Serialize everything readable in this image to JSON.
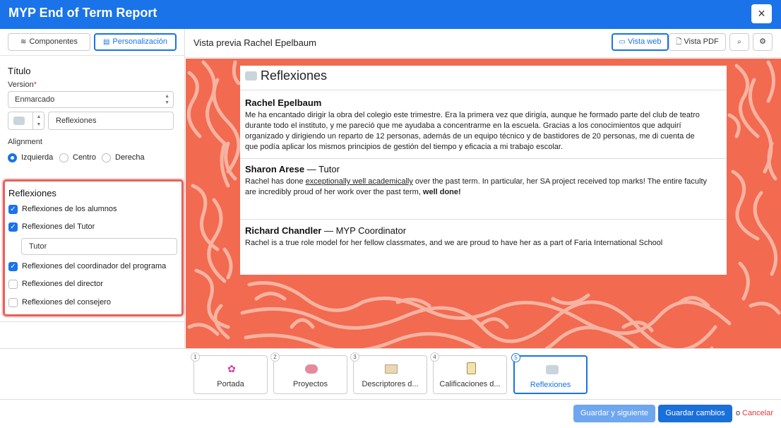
{
  "header": {
    "title": "MYP End of Term Report",
    "close_icon": "×"
  },
  "sidebar": {
    "tabs": [
      {
        "label": "Componentes",
        "icon": "layers-icon"
      },
      {
        "label": "Personalización",
        "icon": "grid-icon",
        "active": true
      }
    ],
    "title_section": {
      "heading": "Título",
      "version_label": "Version",
      "required_mark": "*",
      "version_value": "Enmarcado",
      "icon_value": "💬",
      "title_input_value": "Reflexiones",
      "alignment_label": "Alignment",
      "alignment_options": [
        "Izquierda",
        "Centro",
        "Derecha"
      ],
      "alignment_selected": "Izquierda"
    },
    "reflections": {
      "heading": "Reflexiones",
      "items": [
        {
          "label": "Reflexiones de los alumnos",
          "checked": true
        },
        {
          "label": "Reflexiones del Tutor",
          "checked": true
        },
        {
          "label": "Reflexiones del coordinador del programa",
          "checked": true
        },
        {
          "label": "Reflexiones del director",
          "checked": false
        },
        {
          "label": "Reflexiones del consejero",
          "checked": false
        }
      ],
      "tutor_input_value": "Tutor"
    }
  },
  "preview": {
    "title": "Vista previa Rachel Epelbaum",
    "buttons": {
      "web": "Vista web",
      "pdf": "Vista PDF"
    },
    "background_color": "#f26a50",
    "card": {
      "heading": "Reflexiones",
      "entries": [
        {
          "name": "Rachel Epelbaum",
          "role": "",
          "lines": [
            "Me ha encantado dirigir la obra del colegio este trimestre. Era la primera vez que dirigía, aunque he formado parte del club de teatro",
            "durante todo el instituto, y me pareció que me ayudaba a concentrarme en la escuela. Gracias a los conocimientos que adquirí",
            "organizado y dirigiendo un reparto de 12 personas, además de un equipo técnico y de bastidores de 20 personas, me di cuenta de",
            "que podía aplicar los mismos principios de gestión del tiempo y eficacia a mi trabajo escolar."
          ]
        },
        {
          "name": "Sharon Arese",
          "role": "Tutor",
          "pre": "Rachel has done ",
          "underlined": "exceptionally well academically",
          "mid": " over the past term. In particular, her SA project received top marks! The entire faculty",
          "line2": "are incredibly proud of her work over the past term, ",
          "bold_end": "well done!"
        },
        {
          "name": "Richard Chandler",
          "role": "MYP Coordinator",
          "text": "Rachel is a true role model for her fellow classmates, and we are proud to have her as a part of Faria International School"
        }
      ]
    }
  },
  "steps": [
    {
      "num": "1",
      "label": "Portada",
      "icon": "flower-icon"
    },
    {
      "num": "2",
      "label": "Proyectos",
      "icon": "brain-icon"
    },
    {
      "num": "3",
      "label": "Descriptores d...",
      "icon": "book-icon"
    },
    {
      "num": "4",
      "label": "Calificaciones d...",
      "icon": "clipboard-icon"
    },
    {
      "num": "5",
      "label": "Reflexiones",
      "icon": "speech-bubble-icon",
      "active": true
    }
  ],
  "footer": {
    "save_next": "Guardar y siguiente",
    "save": "Guardar cambios",
    "or": "o",
    "cancel": "Cancelar"
  },
  "colors": {
    "accent": "#1a73e8",
    "highlight": "#e8605a",
    "cancel": "#e53935"
  }
}
